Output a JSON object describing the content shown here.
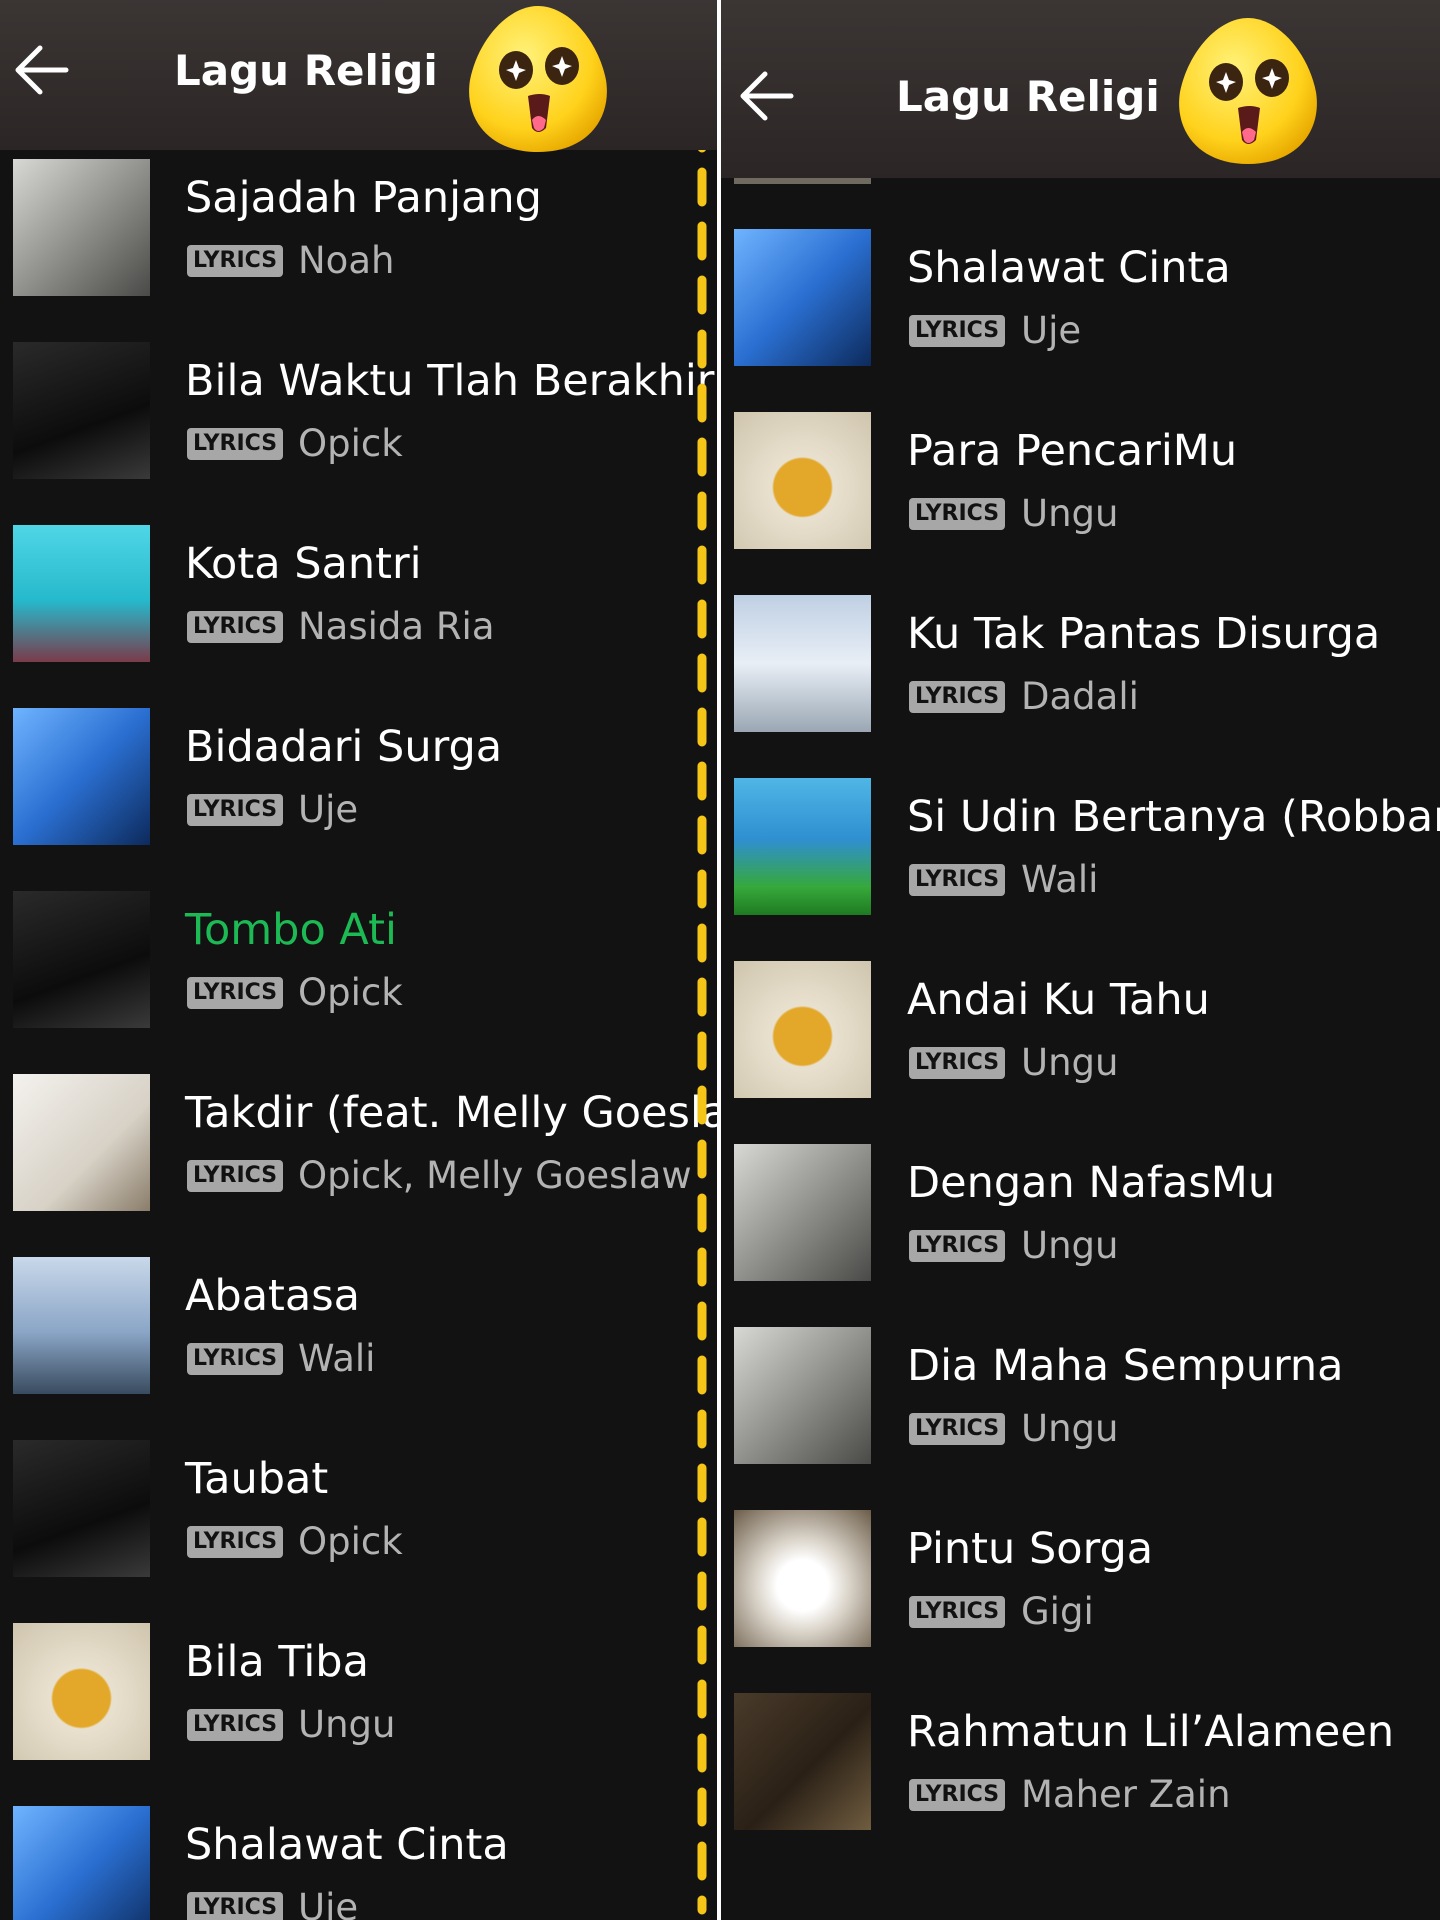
{
  "header": {
    "title": "Lagu Religi"
  },
  "badge_label": "LYRICS",
  "left_tracks": [
    {
      "title": "Sajadah Panjang",
      "artist": "Noah",
      "art": "grey"
    },
    {
      "title": "Bila Waktu Tlah Berakhir",
      "artist": "Opick",
      "art": "dark"
    },
    {
      "title": "Kota Santri",
      "artist": "Nasida Ria",
      "art": "cyan"
    },
    {
      "title": "Bidadari Surga",
      "artist": "Uje",
      "art": "blue"
    },
    {
      "title": "Tombo Ati",
      "artist": "Opick",
      "art": "dark",
      "active": true
    },
    {
      "title": "Takdir (feat. Melly Goeslaw)",
      "artist": "Opick, Melly Goeslaw",
      "art": "white"
    },
    {
      "title": "Abatasa",
      "artist": "Wali",
      "art": "sky"
    },
    {
      "title": "Taubat",
      "artist": "Opick",
      "art": "dark"
    },
    {
      "title": "Bila Tiba",
      "artist": "Ungu",
      "art": "beige"
    },
    {
      "title": "Shalawat Cinta",
      "artist": "Uje",
      "art": "blue"
    }
  ],
  "right_tracks": [
    {
      "title": "Shalawat Cinta",
      "artist": "Uje",
      "art": "blue"
    },
    {
      "title": "Para PencariMu",
      "artist": "Ungu",
      "art": "beige"
    },
    {
      "title": "Ku Tak Pantas Disurga",
      "artist": "Dadali",
      "art": "light"
    },
    {
      "title": "Si Udin Bertanya (Robbana)",
      "artist": "Wali",
      "art": "green"
    },
    {
      "title": "Andai Ku Tahu",
      "artist": "Ungu",
      "art": "beige"
    },
    {
      "title": "Dengan NafasMu",
      "artist": "Ungu",
      "art": "grey"
    },
    {
      "title": "Dia Maha Sempurna",
      "artist": "Ungu",
      "art": "grey"
    },
    {
      "title": "Pintu Sorga",
      "artist": "Gigi",
      "art": "gigi"
    },
    {
      "title": "Rahmatun Lil’Alameen",
      "artist": "Maher Zain",
      "art": "maher"
    }
  ],
  "colors": {
    "background": "#121212",
    "header": "#2f2a29",
    "active": "#1db954",
    "badge": "#a7a7a7",
    "secondary_text": "#b3b3b3",
    "dash": "#f5c518"
  }
}
